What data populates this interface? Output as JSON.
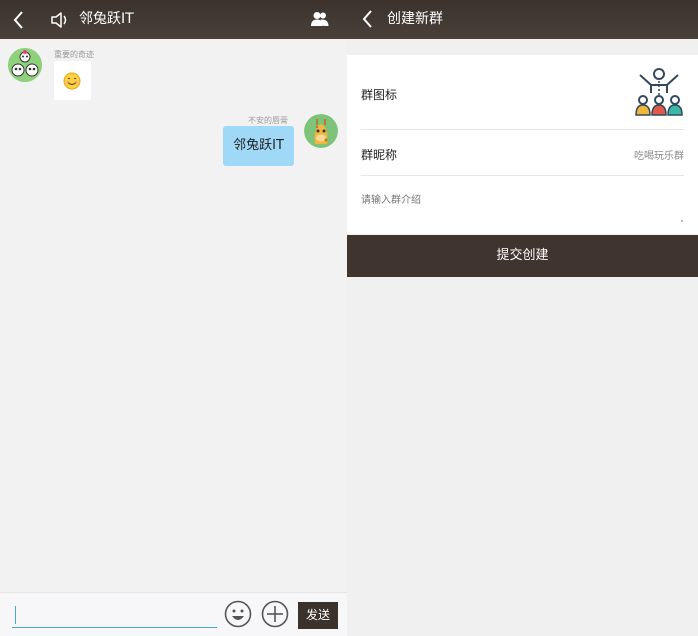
{
  "chat": {
    "title": "邻兔跃IT",
    "back_icon": "back-chevron-icon",
    "speaker_icon": "speaker-icon",
    "members_icon": "group-members-icon",
    "messages": [
      {
        "side": "left",
        "nickname": "重要的奇迹",
        "content_icon": "smile-emoji-icon",
        "avatar": "panda-avatar"
      },
      {
        "side": "right",
        "nickname": "不安的唇膏",
        "text": "邻兔跃IT",
        "avatar": "giraffe-avatar"
      }
    ],
    "input": {
      "value": ""
    },
    "emoji_icon": "emoji-face-icon",
    "plus_icon": "plus-circle-icon",
    "send_label": "发送"
  },
  "create_group": {
    "title": "创建新群",
    "back_icon": "back-chevron-icon",
    "icon_label": "群图标",
    "group_icon": "group-people-icon",
    "nickname_label": "群昵称",
    "nickname_value": "吃喝玩乐群",
    "intro_placeholder": "请输入群介绍",
    "submit_label": "提交创建"
  },
  "colors": {
    "header": "#3b322c",
    "bubble": "#9fd9f7",
    "button": "#40352e",
    "background": "#f2f2f2"
  }
}
